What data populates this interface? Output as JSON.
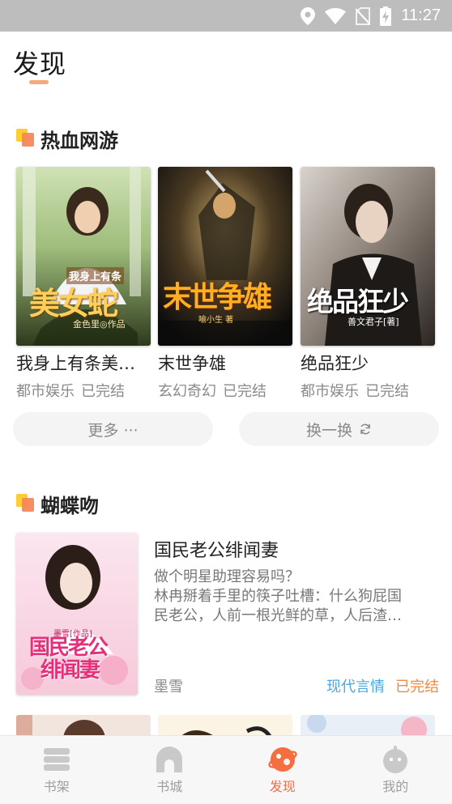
{
  "status_bar": {
    "time": "11:27",
    "icons": [
      "location-icon",
      "wifi-icon",
      "no-sim-icon",
      "battery-charging-icon"
    ]
  },
  "page": {
    "title": "发现"
  },
  "section1": {
    "title": "热血网游",
    "books": [
      {
        "name": "我身上有条美…",
        "category": "都市娱乐",
        "status": "已完结",
        "cover_text": "我身上有条",
        "cover_big": "美女蛇",
        "cover_author": "金色里◎作品"
      },
      {
        "name": "末世争雄",
        "category": "玄幻奇幻",
        "status": "已完结",
        "cover_big": "末世争雄",
        "cover_author": "喻小生 著"
      },
      {
        "name": "绝品狂少",
        "category": "都市娱乐",
        "status": "已完结",
        "cover_big": "绝品狂少",
        "cover_author": "善文君子[著]"
      }
    ],
    "more_label": "更多 ···",
    "refresh_label": "换一换",
    "refresh_icon": "refresh-icon"
  },
  "section2": {
    "title": "蝴蝶吻",
    "featured": {
      "title": "国民老公绯闻妻",
      "desc_line1": "做个明星助理容易吗？",
      "desc_line2": "林冉掰着手里的筷子吐槽：什么狗屁国",
      "desc_line3": "民老公，人前一根光鲜的草，人后渣…",
      "author": "墨雪",
      "genre": "现代言情",
      "status": "已完结",
      "cover_author": "墨雪[作品]",
      "cover_big1": "国民老公",
      "cover_big2": "绯闻妻"
    }
  },
  "colors": {
    "accent": "#f46e40",
    "genre_blue": "#4aa9dc",
    "status_orange": "#f08a3c",
    "underline": "#f5a97a"
  },
  "bottom_nav": {
    "items": [
      {
        "label": "书架",
        "icon": "bookshelf-icon"
      },
      {
        "label": "书城",
        "icon": "bookstore-icon"
      },
      {
        "label": "发现",
        "icon": "discover-icon",
        "active": true
      },
      {
        "label": "我的",
        "icon": "profile-icon"
      }
    ]
  }
}
